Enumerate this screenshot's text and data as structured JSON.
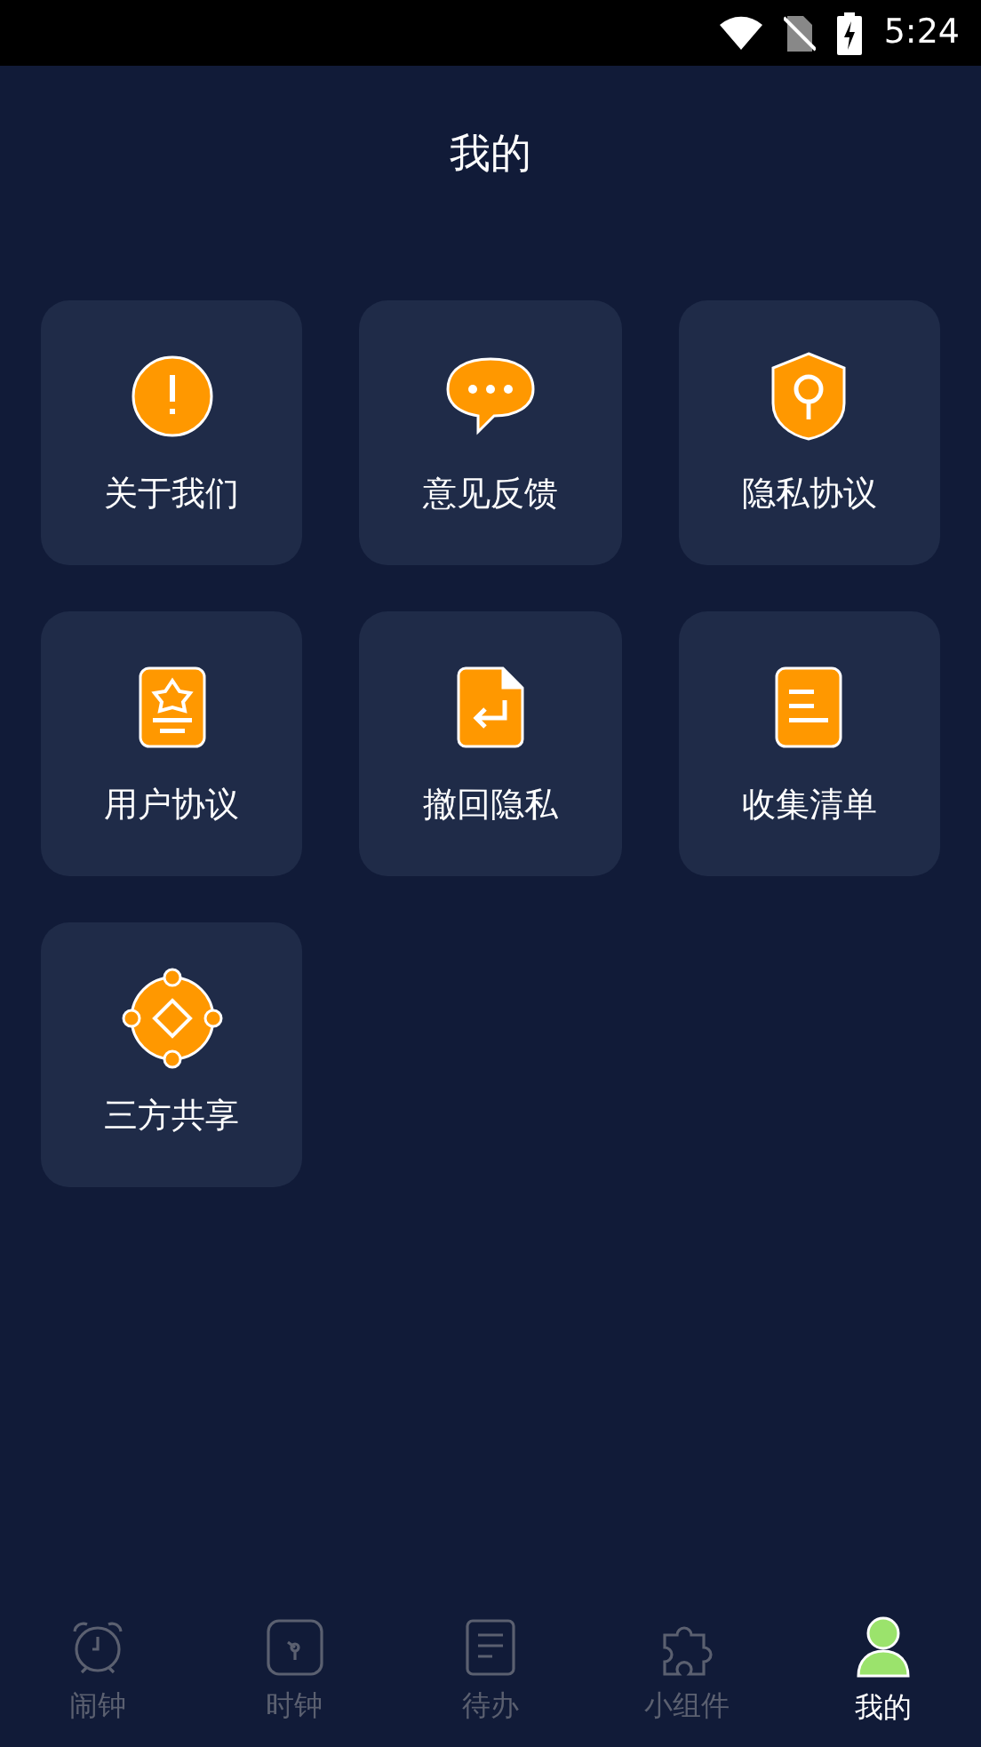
{
  "status_bar": {
    "time": "5:24"
  },
  "header": {
    "title": "我的"
  },
  "menu": [
    {
      "label": "关于我们",
      "kind": "info"
    },
    {
      "label": "意见反馈",
      "kind": "feedback"
    },
    {
      "label": "隐私协议",
      "kind": "privacy"
    },
    {
      "label": "用户协议",
      "kind": "agreement"
    },
    {
      "label": "撤回隐私",
      "kind": "revoke"
    },
    {
      "label": "收集清单",
      "kind": "list"
    },
    {
      "label": "三方共享",
      "kind": "share"
    }
  ],
  "tabs": [
    {
      "label": "闹钟",
      "kind": "alarm",
      "selected": false
    },
    {
      "label": "时钟",
      "kind": "clock",
      "selected": false
    },
    {
      "label": "待办",
      "kind": "todo",
      "selected": false
    },
    {
      "label": "小组件",
      "kind": "widget",
      "selected": false
    },
    {
      "label": "我的",
      "kind": "profile",
      "selected": true
    }
  ]
}
